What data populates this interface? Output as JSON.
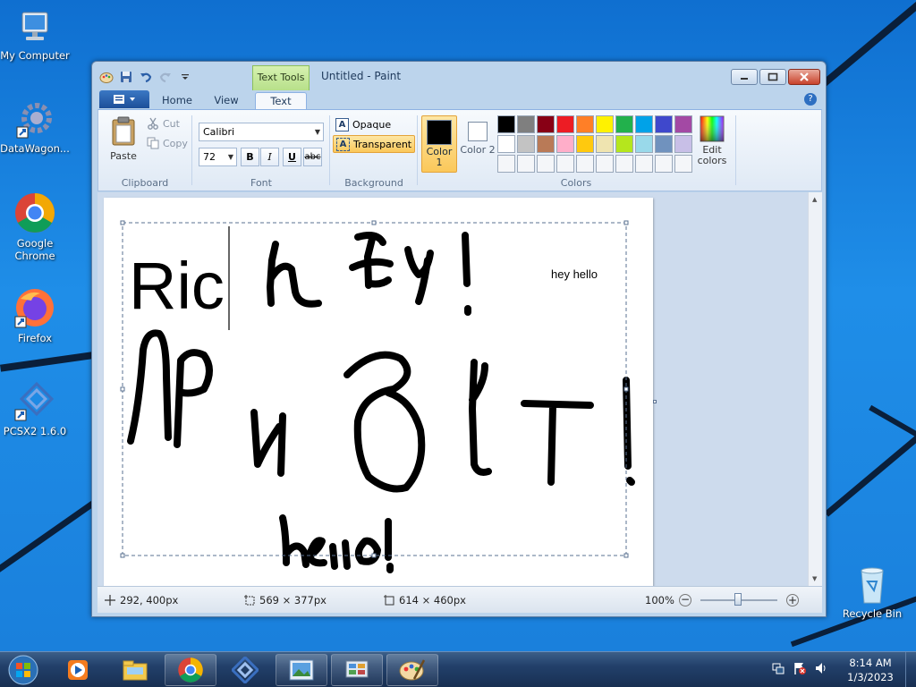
{
  "desktop": {
    "icons": [
      {
        "label": "My Computer",
        "icon": "computer-icon"
      },
      {
        "label": "DataWagon...",
        "icon": "gear-shortcut-icon"
      },
      {
        "label": "Google Chrome",
        "icon": "chrome-icon"
      },
      {
        "label": "Firefox",
        "icon": "firefox-icon"
      },
      {
        "label": "PCSX2 1.6.0",
        "icon": "pcsx2-icon"
      },
      {
        "label": "Recycle Bin",
        "icon": "recycle-bin-icon"
      }
    ]
  },
  "window": {
    "title": "Untitled - Paint",
    "contextual_tab": "Text Tools",
    "tabs": [
      {
        "label": "Home",
        "active": false
      },
      {
        "label": "View",
        "active": false
      },
      {
        "label": "Text",
        "active": true
      }
    ]
  },
  "ribbon": {
    "clipboard": {
      "label": "Clipboard",
      "paste": "Paste",
      "cut": "Cut",
      "copy": "Copy"
    },
    "font": {
      "label": "Font",
      "family": "Calibri",
      "size": "72",
      "bold": "B",
      "italic": "I",
      "underline": "U",
      "strike": "abc"
    },
    "background": {
      "label": "Background",
      "opaque": "Opaque",
      "transparent": "Transparent",
      "selected": "Transparent"
    },
    "colors": {
      "label": "Colors",
      "color1_label": "Color 1",
      "color2_label": "Color 2",
      "color1": "#000000",
      "color2": "#ffffff",
      "edit_label": "Edit colors",
      "palette": [
        "#000000",
        "#7f7f7f",
        "#880015",
        "#ed1c24",
        "#ff7f27",
        "#fff200",
        "#22b14c",
        "#00a2e8",
        "#3f48cc",
        "#a349a4",
        "#ffffff",
        "#c3c3c3",
        "#b97a57",
        "#ffaec9",
        "#ffc90e",
        "#efe4b0",
        "#b5e61d",
        "#99d9ea",
        "#7092be",
        "#c8bfe7",
        "#f4f6f9",
        "#f4f6f9",
        "#f4f6f9",
        "#f4f6f9",
        "#f4f6f9",
        "#f4f6f9",
        "#f4f6f9",
        "#f4f6f9",
        "#f4f6f9",
        "#f4f6f9"
      ]
    }
  },
  "canvas": {
    "typed_text": "Ric",
    "small_text": "hey hello",
    "handwriting": [
      "hey!",
      "привет!",
      "hello!"
    ]
  },
  "status": {
    "cursor": "292, 400px",
    "selection": "569 × 377px",
    "canvas_size": "614 × 460px",
    "zoom": "100%"
  },
  "taskbar": {
    "time": "8:14 AM",
    "date": "1/3/2023",
    "apps": [
      "media-player-icon",
      "file-explorer-icon",
      "chrome-icon",
      "pcsx2-icon",
      "photo-viewer-icon",
      "control-panel-icon",
      "paint-icon"
    ]
  }
}
